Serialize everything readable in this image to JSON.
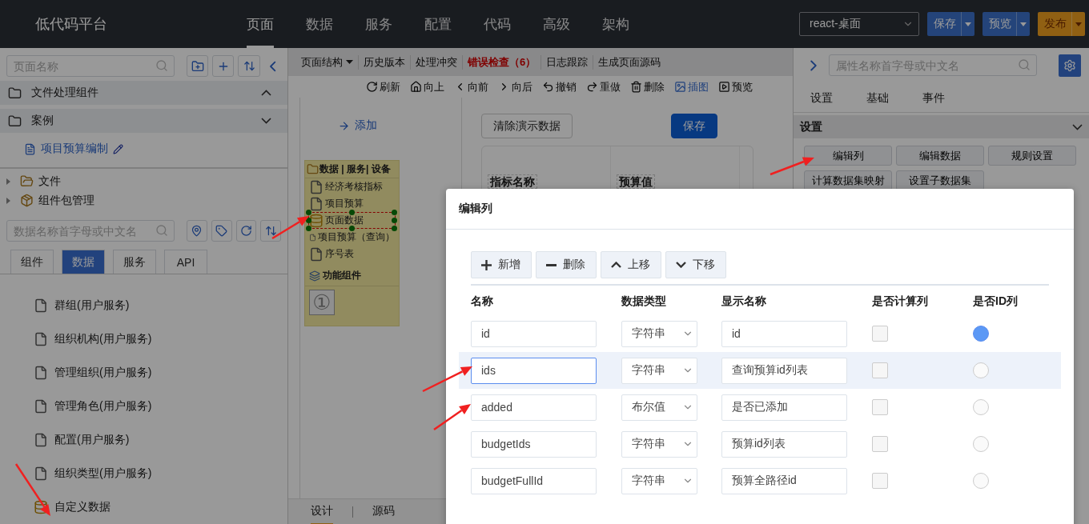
{
  "app": {
    "title": "低代码平台"
  },
  "nav": [
    {
      "label": "页面",
      "selected": true
    },
    {
      "label": "数据",
      "selected": false
    },
    {
      "label": "服务",
      "selected": false
    },
    {
      "label": "配置",
      "selected": false
    },
    {
      "label": "代码",
      "selected": false
    },
    {
      "label": "高级",
      "selected": false
    },
    {
      "label": "架构",
      "selected": false
    }
  ],
  "top_actions": {
    "platform": "react-桌面",
    "buttons": [
      {
        "label": "保存",
        "kind": "primary"
      },
      {
        "label": "预览",
        "kind": "primary"
      },
      {
        "label": "发布",
        "kind": "warning"
      }
    ]
  },
  "left_panel": {
    "page_search": {
      "placeholder": "页面名称"
    },
    "groups": [
      {
        "label": "文件处理组件",
        "expanded": true
      },
      {
        "label": "案例",
        "expanded": false
      }
    ],
    "pages": [
      {
        "label": "项目预算编制"
      }
    ],
    "tree": [
      {
        "label": "文件",
        "kind": "folder"
      },
      {
        "label": "组件包管理",
        "kind": "package"
      }
    ],
    "data_search": {
      "placeholder": "数据名称首字母或中文名"
    },
    "tabs": [
      {
        "label": "组件",
        "selected": false
      },
      {
        "label": "数据",
        "selected": true
      },
      {
        "label": "服务",
        "selected": false
      },
      {
        "label": "API",
        "selected": false
      }
    ],
    "data_items": [
      {
        "label": "群组(用户服务)",
        "kind": "dataset"
      },
      {
        "label": "组织机构(用户服务)",
        "kind": "dataset"
      },
      {
        "label": "管理组织(用户服务)",
        "kind": "dataset"
      },
      {
        "label": "管理角色(用户服务)",
        "kind": "dataset"
      },
      {
        "label": "配置(用户服务)",
        "kind": "dataset"
      },
      {
        "label": "组织类型(用户服务)",
        "kind": "dataset"
      },
      {
        "label": "自定义数据",
        "kind": "custom"
      }
    ]
  },
  "editor": {
    "menu": [
      {
        "label": "页面结构",
        "kind": "dropdown"
      },
      {
        "label": "历史版本",
        "kind": "plain"
      },
      {
        "label": "处理冲突",
        "kind": "plain"
      },
      {
        "label": "错误检查（6）",
        "kind": "error"
      },
      {
        "label": "日志跟踪",
        "kind": "plain"
      },
      {
        "label": "生成页面源码",
        "kind": "plain"
      }
    ],
    "toolbar": [
      {
        "label": "刷新",
        "active": false
      },
      {
        "label": "向上",
        "active": false
      },
      {
        "label": "向前",
        "active": false
      },
      {
        "label": "向后",
        "active": false
      },
      {
        "label": "撤销",
        "active": false
      },
      {
        "label": "重做",
        "active": false
      },
      {
        "label": "删除",
        "active": false
      },
      {
        "label": "插图",
        "active": true
      },
      {
        "label": "预览",
        "active": false
      }
    ],
    "add_link": "添加",
    "palette": {
      "header": "数据 | 服务| 设备",
      "items": [
        {
          "label": "经济考核指标",
          "kind": "dataset",
          "selected": false
        },
        {
          "label": "项目预算",
          "kind": "dataset",
          "selected": false
        },
        {
          "label": "页面数据",
          "kind": "custom",
          "selected": true
        },
        {
          "label": "项目预算（查询）",
          "kind": "dataset",
          "selected": false
        },
        {
          "label": "序号表",
          "kind": "dataset",
          "selected": false
        }
      ],
      "section": "功能组件",
      "widgets": [
        "①"
      ]
    },
    "design": {
      "buttons": [
        {
          "label": "清除演示数据",
          "kind": "default"
        },
        {
          "label": "保存",
          "kind": "primary"
        }
      ],
      "table_columns": [
        "指标名称",
        "预算值"
      ]
    },
    "bottom_tabs": [
      {
        "label": "设计",
        "selected": true
      },
      {
        "label": "源码",
        "selected": false
      }
    ]
  },
  "right_panel": {
    "search": {
      "placeholder": "属性名称首字母或中文名"
    },
    "tabs": [
      "设置",
      "基础",
      "事件"
    ],
    "section": {
      "title": "设置",
      "expanded": false
    },
    "buttons": [
      "编辑列",
      "编辑数据",
      "规则设置",
      "计算数据集映射",
      "设置子数据集"
    ]
  },
  "dialog": {
    "title": "编辑列",
    "toolbar": [
      {
        "label": "新增",
        "kind": "add"
      },
      {
        "label": "删除",
        "kind": "remove"
      },
      {
        "label": "上移",
        "kind": "up"
      },
      {
        "label": "下移",
        "kind": "down"
      }
    ],
    "columns": [
      "名称",
      "数据类型",
      "显示名称",
      "是否计算列",
      "是否ID列"
    ],
    "rows": [
      {
        "name": "id",
        "type": "字符串",
        "display": "id",
        "computed": false,
        "is_id": true,
        "selected": false
      },
      {
        "name": "ids",
        "type": "字符串",
        "display": "查询预算id列表",
        "computed": false,
        "is_id": false,
        "selected": true
      },
      {
        "name": "added",
        "type": "布尔值",
        "display": "是否已添加",
        "computed": false,
        "is_id": false,
        "selected": false
      },
      {
        "name": "budgetIds",
        "type": "字符串",
        "display": "预算id列表",
        "computed": false,
        "is_id": false,
        "selected": false
      },
      {
        "name": "budgetFullId",
        "type": "字符串",
        "display": "预算全路径id",
        "computed": false,
        "is_id": false,
        "selected": false
      }
    ]
  }
}
